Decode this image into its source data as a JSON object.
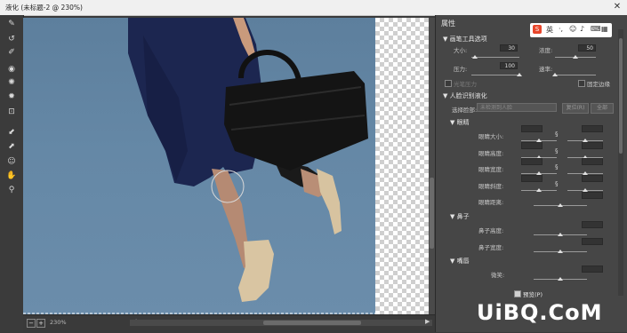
{
  "window": {
    "title": "液化 (未标题-2 @ 230%)",
    "close_label": "✕"
  },
  "tools": [
    "warp-tool-icon",
    "reconstruct-tool-icon",
    "smooth-tool-icon",
    "twirl-tool-icon",
    "pucker-tool-icon",
    "bloat-tool-icon",
    "push-left-tool-icon",
    "freeze-mask-tool-icon",
    "thaw-mask-tool-icon",
    "face-tool-icon",
    "hand-tool-icon",
    "zoom-tool-icon"
  ],
  "status": {
    "zoom": "230%"
  },
  "panel": {
    "title": "属性",
    "brush_section": "画笔工具选项",
    "size_label": "大小:",
    "size_value": "30",
    "size_level": 0.05,
    "density_label": "浓度:",
    "density_value": "50",
    "density_level": 0.5,
    "pressure_label": "压力:",
    "pressure_value": "100",
    "pressure_level": 1.0,
    "rate_label": "速率:",
    "rate_level": 0,
    "stylus_label": "光笔压力",
    "pin_edges_label": "固定边缘",
    "face_section": "人脸识别液化",
    "select_face_label": "选择脸部:",
    "select_face_value": "未检测到人脸",
    "reset_label": "复位(R)",
    "all_label": "全部",
    "eyes_section": "眼睛",
    "eye_size": "眼睛大小:",
    "eye_height": "眼睛高度:",
    "eye_width": "眼睛宽度:",
    "eye_tilt": "眼睛斜度:",
    "eye_distance": "眼睛距离:",
    "nose_section": "鼻子",
    "nose_height": "鼻子高度:",
    "nose_width": "鼻子宽度:",
    "mouth_section": "嘴唇",
    "smile": "微笑:",
    "preview_label": "预览(P)"
  },
  "ime": {
    "badge": "S",
    "lang": "英"
  },
  "watermark": "UiBQ.CoM"
}
